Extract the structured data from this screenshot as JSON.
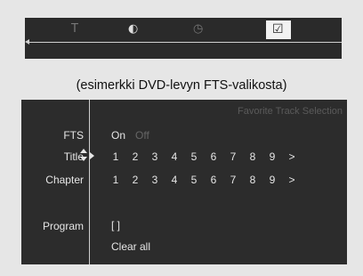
{
  "topbar": {
    "tabs": [
      {
        "icon": "subtitle-T-icon",
        "glyph": "T",
        "selected": false
      },
      {
        "icon": "brightness-icon",
        "glyph": "◐",
        "selected": false
      },
      {
        "icon": "clock-icon",
        "glyph": "◷",
        "selected": false
      },
      {
        "icon": "checkbox-checked-icon",
        "glyph": "☑",
        "selected": true
      }
    ]
  },
  "caption": "(esimerkki DVD-levyn FTS-valikosta)",
  "menu": {
    "header": "Favorite Track Selection",
    "fts": {
      "label": "FTS",
      "on": "On",
      "off": "Off"
    },
    "title": {
      "label": "Title",
      "numbers": [
        "1",
        "2",
        "3",
        "4",
        "5",
        "6",
        "7",
        "8",
        "9"
      ],
      "more": ">"
    },
    "chapter": {
      "label": "Chapter",
      "numbers": [
        "1",
        "2",
        "3",
        "4",
        "5",
        "6",
        "7",
        "8",
        "9"
      ],
      "more": ">"
    },
    "program": {
      "label": "Program",
      "value": "[ ]",
      "clear": "Clear all"
    }
  }
}
